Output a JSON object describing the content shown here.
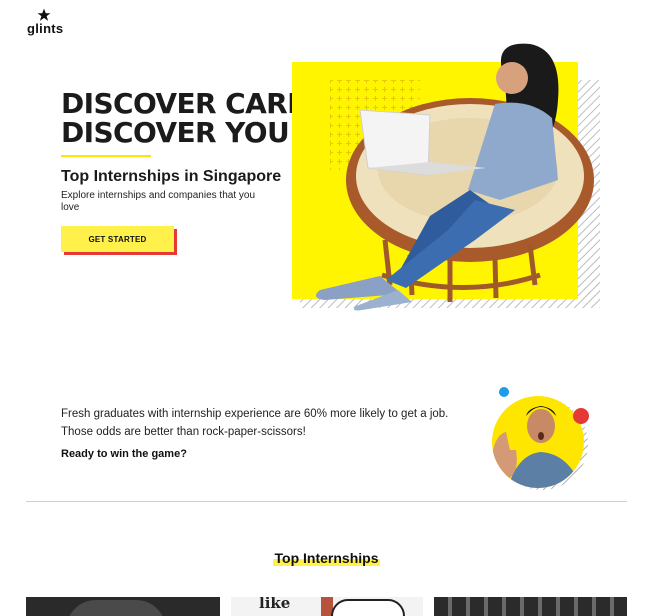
{
  "brand": {
    "name": "glints"
  },
  "hero": {
    "title_line1": "DISCOVER CAREERS,",
    "title_line2": "DISCOVER YOU",
    "subtitle": "Top Internships in Singapore",
    "description": "Explore internships and companies that you love",
    "cta_label": "GET STARTED"
  },
  "promo": {
    "line1": "Fresh graduates with internship experience are 60% more likely to get a job.",
    "line2": "Those odds are better than rock-paper-scissors!",
    "question": "Ready to win the game?"
  },
  "section": {
    "title": "Top Internships"
  },
  "cards": {
    "card2_text": "like"
  },
  "colors": {
    "accent_yellow": "#ffe600",
    "cta_shadow": "#e53935",
    "dot_blue": "#1e9be9",
    "dot_red": "#e53935"
  }
}
